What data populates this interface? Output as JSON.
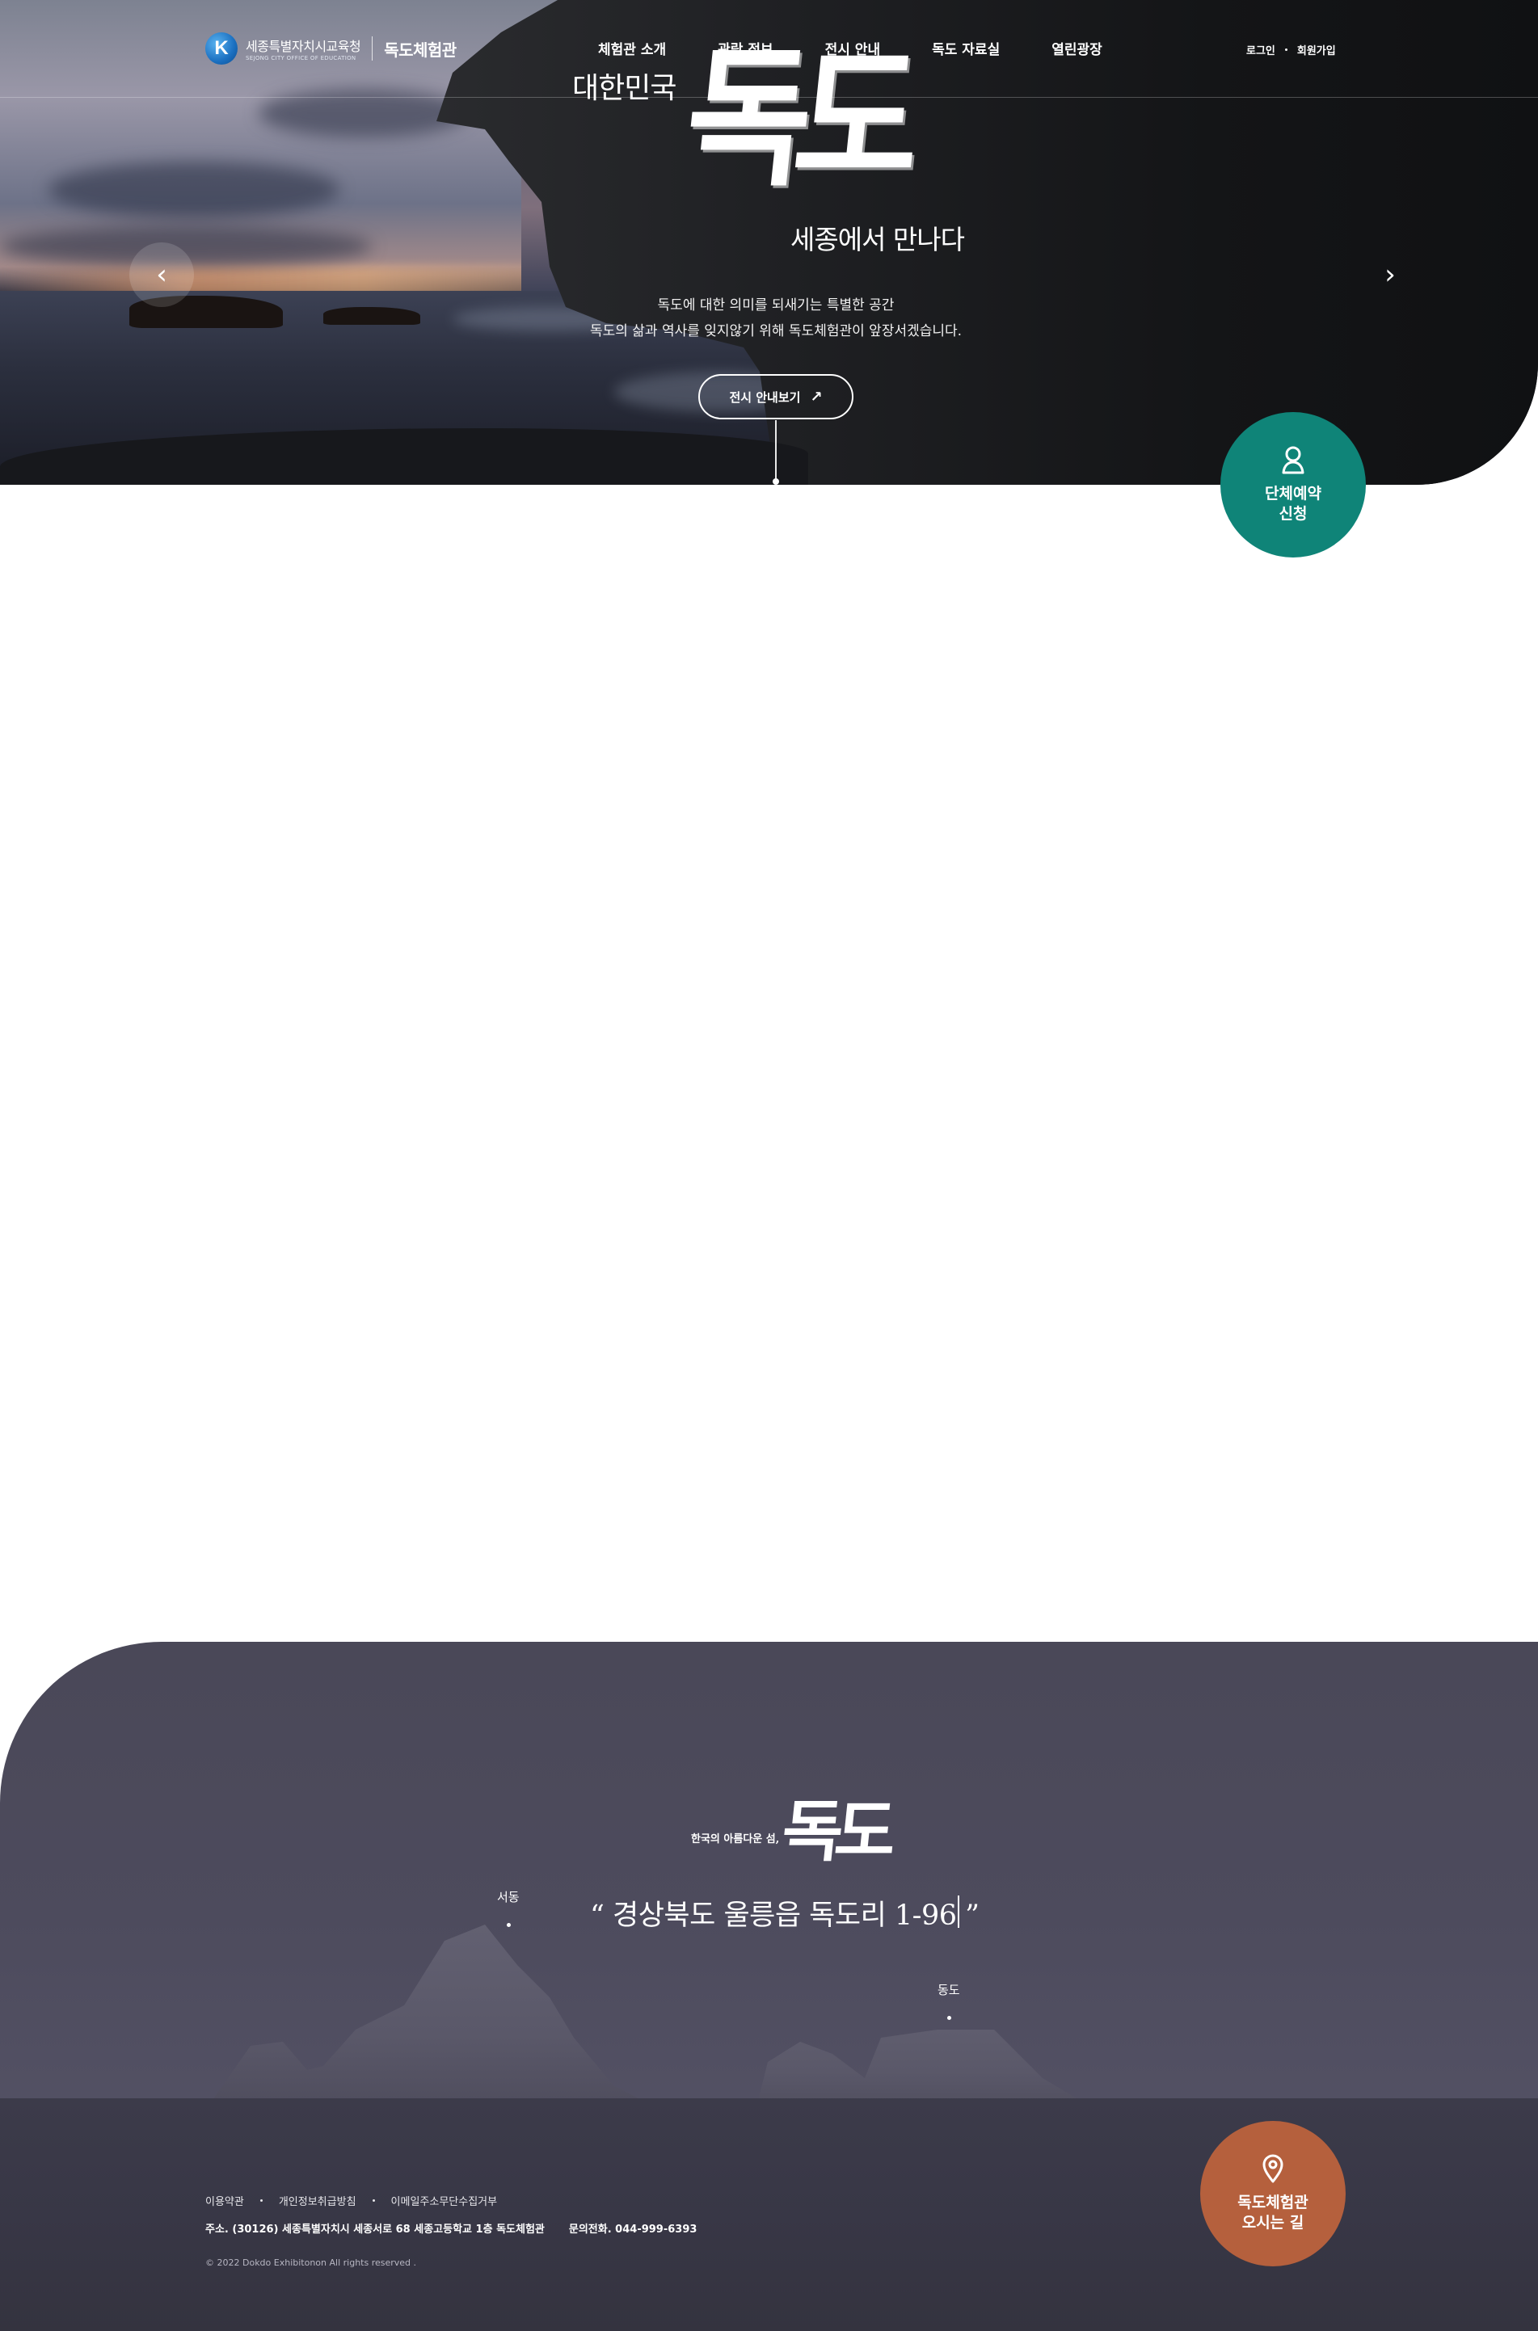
{
  "header": {
    "logo_org": "세종특별자치시교육청",
    "logo_org_en": "SEJONG CITY OFFICE OF EDUCATION",
    "logo_site": "독도체험관",
    "nav": [
      {
        "label": "체험관 소개"
      },
      {
        "label": "관람 정보"
      },
      {
        "label": "전시 안내"
      },
      {
        "label": "독도 자료실"
      },
      {
        "label": "열린광장"
      }
    ],
    "login": "로그인",
    "signup": "회원가입"
  },
  "hero": {
    "title_prefix": "대한민국",
    "title_main": "독도",
    "title_suffix": "세종에서 만나다",
    "desc_line1": "독도에 대한 의미를 되새기는 특별한 공간",
    "desc_line2": "독도의 삶과 역사를 잊지않기 위해 독도체험관이 앞장서겠습니다.",
    "cta_label": "전시 안내보기",
    "cta_arrow": "↗",
    "prev_arrow": "‹",
    "next_arrow": "›"
  },
  "floating": {
    "reserve_line1": "단체예약",
    "reserve_line2": "신청",
    "directions_line1": "독도체험관",
    "directions_line2": "오시는 길"
  },
  "location": {
    "kicker": "한국의 아름다운 섬,",
    "callig": "독도",
    "address": "“ 경상북도 울릉읍 독도리 1-96 ”",
    "west_label": "서동",
    "east_label": "동도"
  },
  "footer": {
    "links": [
      {
        "label": "이용약관"
      },
      {
        "label": "개인정보취급방침"
      },
      {
        "label": "이메일주소무단수집거부"
      }
    ],
    "address": "주소. (30126) 세종특별자치시 세종서로 68 세종고등학교 1층 독도체험관",
    "phone": "문의전화. 044-999-6393",
    "copyright": "© 2022 Dokdo Exhibitonon All rights reserved ."
  },
  "colors": {
    "reserve_bg": "#0f8478",
    "directions_bg": "#b5603d",
    "bottom_bg": "#4a4858"
  }
}
